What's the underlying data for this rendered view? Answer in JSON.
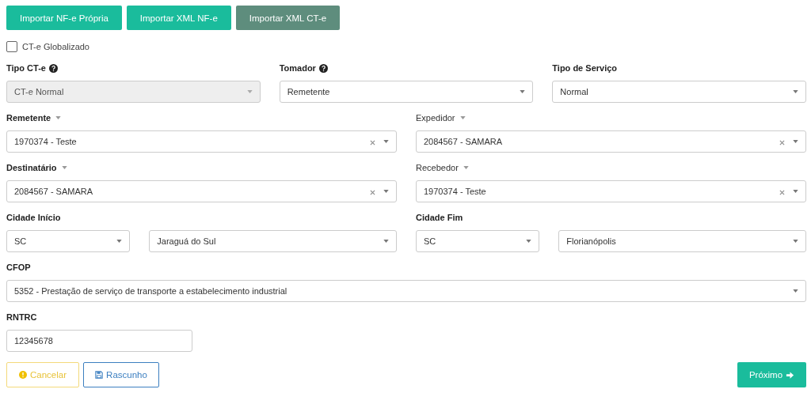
{
  "import_buttons": [
    {
      "label": "Importar NF-e Própria",
      "selected": false
    },
    {
      "label": "Importar XML NF-e",
      "selected": false
    },
    {
      "label": "Importar XML CT-e",
      "selected": true
    }
  ],
  "globalizado": {
    "label": "CT-e Globalizado",
    "checked": false
  },
  "rows": [
    {
      "fields": [
        {
          "label": "Tipo CT-e",
          "bold": true,
          "label_icon": {
            "kind": "help"
          },
          "controls": [
            {
              "kind": "select",
              "value": "CT-e Normal",
              "disabled": true
            }
          ]
        },
        {
          "label": "Tomador",
          "bold": true,
          "label_icon": {
            "kind": "help"
          },
          "controls": [
            {
              "kind": "select",
              "value": "Remetente",
              "disabled": false
            }
          ]
        },
        {
          "label": "Tipo de Serviço",
          "bold": true,
          "controls": [
            {
              "kind": "select",
              "value": "Normal",
              "disabled": false
            }
          ]
        }
      ]
    },
    {
      "fields": [
        {
          "label": "Remetente",
          "bold": true,
          "label_icon": {
            "kind": "caret"
          },
          "controls": [
            {
              "kind": "clearable-select",
              "value": "1970374 - Teste",
              "disabled": false
            }
          ]
        },
        {
          "label": "Expedidor",
          "bold": false,
          "label_icon": {
            "kind": "caret"
          },
          "controls": [
            {
              "kind": "clearable-select",
              "value": "2084567 - SAMARA",
              "disabled": false
            }
          ]
        }
      ]
    },
    {
      "fields": [
        {
          "label": "Destinatário",
          "bold": true,
          "label_icon": {
            "kind": "caret"
          },
          "controls": [
            {
              "kind": "clearable-select",
              "value": "2084567 - SAMARA",
              "disabled": false
            }
          ]
        },
        {
          "label": "Recebedor",
          "bold": false,
          "label_icon": {
            "kind": "caret"
          },
          "controls": [
            {
              "kind": "clearable-select",
              "value": "1970374 - Teste",
              "disabled": false
            }
          ]
        }
      ]
    },
    {
      "fields": [
        {
          "label": "Cidade Início",
          "bold": true,
          "controls": [
            {
              "kind": "select",
              "value": "SC",
              "disabled": false
            },
            {
              "kind": "select",
              "value": "Jaraguá do Sul",
              "disabled": false
            }
          ]
        },
        {
          "label": "Cidade Fim",
          "bold": true,
          "controls": [
            {
              "kind": "select",
              "value": "SC",
              "disabled": false
            },
            {
              "kind": "select",
              "value": "Florianópolis",
              "disabled": false
            }
          ]
        }
      ]
    },
    {
      "fields": [
        {
          "label": "CFOP",
          "bold": true,
          "controls": [
            {
              "kind": "select",
              "value": "5352 - Prestação de serviço de transporte a estabelecimento industrial",
              "disabled": false
            }
          ]
        }
      ]
    },
    {
      "fields": [
        {
          "label": "RNTRC",
          "bold": true,
          "controls": [
            {
              "kind": "text",
              "value": "12345678",
              "disabled": false
            }
          ]
        }
      ]
    }
  ],
  "footer_buttons": [
    {
      "label": "Cancelar",
      "kind": "cancel"
    },
    {
      "label": "Rascunho",
      "kind": "draft"
    },
    {
      "label": "Próximo",
      "kind": "next"
    }
  ]
}
